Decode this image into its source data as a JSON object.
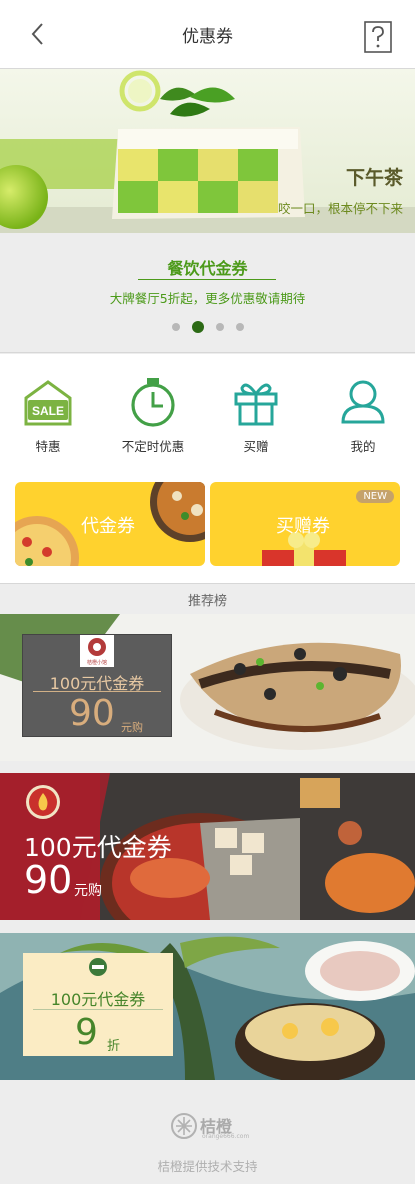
{
  "header": {
    "title": "优惠券",
    "back_icon": "chevron-left-icon",
    "help_icon": "question-icon"
  },
  "banner": {
    "title": "下午茶",
    "subtitle": "咬一口，根本停不下来",
    "caption_title": "餐饮代金券",
    "caption_subtitle": "大牌餐厅5折起，更多优惠敬请期待",
    "slide_count": 4,
    "active_slide": 2
  },
  "categories": [
    {
      "label": "特惠",
      "icon": "sale-tag-icon",
      "badge_text": "SALE",
      "color": "#7cb342"
    },
    {
      "label": "不定时优惠",
      "icon": "alarm-clock-icon",
      "color": "#43a047"
    },
    {
      "label": "买赠",
      "icon": "gift-icon",
      "color": "#26a69a"
    },
    {
      "label": "我的",
      "icon": "user-icon",
      "color": "#26a69a"
    }
  ],
  "promos": [
    {
      "label": "代金券"
    },
    {
      "label": "买赠券",
      "badge": "NEW"
    }
  ],
  "section": {
    "title": "推荐榜"
  },
  "cards": [
    {
      "logo_text": "桔橙小馆",
      "title": "100元代金券",
      "price": "90",
      "unit": "元购"
    },
    {
      "title": "100元代金券",
      "price": "90",
      "unit": "元购"
    },
    {
      "title": "100元代金券",
      "price": "9",
      "unit": "折"
    }
  ],
  "footer": {
    "brand": "桔橙",
    "domain": "orange666.com",
    "text": "桔橙提供技术支持"
  },
  "colors": {
    "accent_green": "#4c9a1a",
    "promo_yellow": "#ffd22e",
    "card2_red": "#a4202b"
  }
}
